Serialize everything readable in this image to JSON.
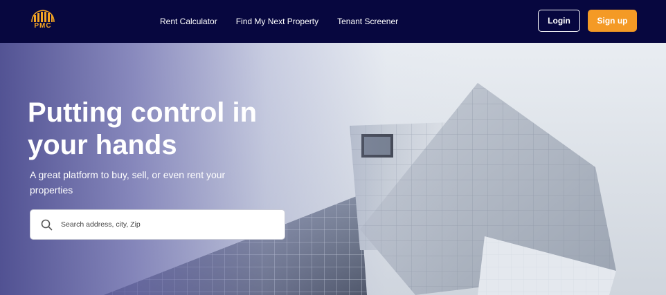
{
  "brand": {
    "logo_text": "PMC",
    "colors": {
      "navy": "#07073f",
      "accent": "#f49a25",
      "white": "#ffffff"
    }
  },
  "nav": {
    "links": [
      {
        "label": "Rent Calculator"
      },
      {
        "label": "Find My Next Property"
      },
      {
        "label": "Tenant Screener"
      }
    ],
    "login_label": "Login",
    "signup_label": "Sign up"
  },
  "hero": {
    "title": "Putting control in your hands",
    "subtitle": "A great platform to buy, sell, or even rent your properties",
    "background_image": "modern-glass-building",
    "search": {
      "placeholder": "Search address, city, Zip",
      "value": "",
      "icon": "search-icon"
    }
  }
}
